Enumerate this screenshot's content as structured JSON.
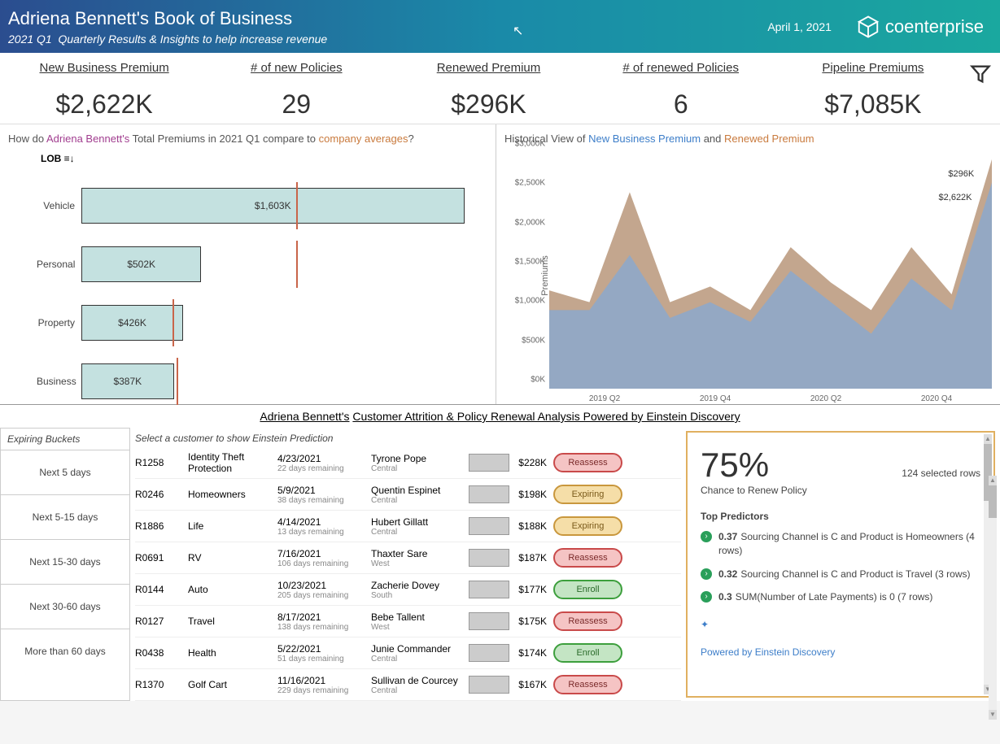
{
  "header": {
    "owner": "Adriena Bennett's",
    "title_rest": "Book of Business",
    "subtitle_period": "2021 Q1",
    "subtitle_rest": "Quarterly Results & Insights to help increase revenue",
    "date": "April 1, 2021",
    "brand": "coenterprise"
  },
  "kpis": [
    {
      "label": "New Business Premium",
      "value": "$2,622K"
    },
    {
      "label": "# of new Policies",
      "value": "29"
    },
    {
      "label": "Renewed Premium",
      "value": "$296K"
    },
    {
      "label": "# of renewed Policies",
      "value": "6"
    },
    {
      "label": "Pipeline Premiums",
      "value": "$7,085K"
    }
  ],
  "chart_data": [
    {
      "type": "bar",
      "title_parts": {
        "pre": "How do ",
        "who": "Adriena Bennett's",
        "mid": " Total Premiums in 2021 Q1 compare to ",
        "ref": "company averages",
        "post": "?"
      },
      "axis_label": "LOB ≡↓",
      "categories": [
        "Vehicle",
        "Personal",
        "Property",
        "Business"
      ],
      "values": [
        1603,
        502,
        426,
        387
      ],
      "value_labels": [
        "$1,603K",
        "$502K",
        "$426K",
        "$387K"
      ],
      "company_avg": [
        900,
        900,
        380,
        400
      ],
      "xmax": 1700
    },
    {
      "type": "area",
      "title_parts": {
        "pre": "Historical View of ",
        "s1": "New Business Premium",
        "mid": " and ",
        "s2": "Renewed Premium"
      },
      "ylabel": "Premiums",
      "y_ticks": [
        "$0K",
        "$500K",
        "$1,000K",
        "$1,500K",
        "$2,000K",
        "$2,500K",
        "$3,000K"
      ],
      "x_ticks": [
        "2019 Q2",
        "2019 Q4",
        "2020 Q2",
        "2020 Q4"
      ],
      "series": [
        {
          "name": "New Business Premium",
          "color": "#8fa8c9",
          "values": [
            1000,
            1000,
            1700,
            900,
            1100,
            850,
            1500,
            1100,
            700,
            1400,
            1000,
            2622
          ]
        },
        {
          "name": "Renewed Premium",
          "color": "#b8977a",
          "values": [
            250,
            100,
            800,
            200,
            200,
            150,
            300,
            250,
            300,
            400,
            200,
            296
          ]
        }
      ],
      "callouts": [
        {
          "text": "$296K",
          "x": 0.96,
          "y": 0.07
        },
        {
          "text": "$2,622K",
          "x": 0.955,
          "y": 0.17
        }
      ],
      "ylim": [
        0,
        3000
      ]
    }
  ],
  "attrition": {
    "title_who": "Adriena Bennett's",
    "title_rest": "Customer Attrition & Policy Renewal Analysis Powered by Einstein Discovery",
    "buckets_head": "Expiring Buckets",
    "table_head": "Select a customer to show Einstein Prediction",
    "buckets": [
      "Next 5 days",
      "Next 5-15 days",
      "Next 15-30 days",
      "Next 30-60 days",
      "More than 60 days"
    ],
    "rows": [
      {
        "id": "R1258",
        "product": "Identity Theft Protection",
        "date": "4/23/2021",
        "days": "22 days remaining",
        "agent": "Tyrone Pope",
        "region": "Central",
        "value": "$228K",
        "action": "Reassess",
        "cls": "reassess"
      },
      {
        "id": "R0246",
        "product": "Homeowners",
        "date": "5/9/2021",
        "days": "38 days remaining",
        "agent": "Quentin Espinet",
        "region": "Central",
        "value": "$198K",
        "action": "Expiring",
        "cls": "expiring"
      },
      {
        "id": "R1886",
        "product": "Life",
        "date": "4/14/2021",
        "days": "13 days remaining",
        "agent": "Hubert Gillatt",
        "region": "Central",
        "value": "$188K",
        "action": "Expiring",
        "cls": "expiring"
      },
      {
        "id": "R0691",
        "product": "RV",
        "date": "7/16/2021",
        "days": "106 days remaining",
        "agent": "Thaxter Sare",
        "region": "West",
        "value": "$187K",
        "action": "Reassess",
        "cls": "reassess"
      },
      {
        "id": "R0144",
        "product": "Auto",
        "date": "10/23/2021",
        "days": "205 days remaining",
        "agent": "Zacherie Dovey",
        "region": "South",
        "value": "$177K",
        "action": "Enroll",
        "cls": "enroll"
      },
      {
        "id": "R0127",
        "product": "Travel",
        "date": "8/17/2021",
        "days": "138 days remaining",
        "agent": "Bebe Tallent",
        "region": "West",
        "value": "$175K",
        "action": "Reassess",
        "cls": "reassess"
      },
      {
        "id": "R0438",
        "product": "Health",
        "date": "5/22/2021",
        "days": "51 days remaining",
        "agent": "Junie Commander",
        "region": "Central",
        "value": "$174K",
        "action": "Enroll",
        "cls": "enroll"
      },
      {
        "id": "R1370",
        "product": "Golf Cart",
        "date": "11/16/2021",
        "days": "229 days remaining",
        "agent": "Sullivan de Courcey",
        "region": "Central",
        "value": "$167K",
        "action": "Reassess",
        "cls": "reassess"
      }
    ]
  },
  "einstein": {
    "percent": "75%",
    "label": "Chance to Renew Policy",
    "selected": "124 selected rows",
    "predictors_head": "Top Predictors",
    "predictors": [
      {
        "score": "0.37",
        "text": "Sourcing Channel is C and Product is Homeowners (4 rows)"
      },
      {
        "score": "0.32",
        "text": "Sourcing Channel is C and Product is Travel (3 rows)"
      },
      {
        "score": "0.3",
        "text": "SUM(Number of Late Payments) is 0 (7 rows)"
      }
    ],
    "powered": "Powered by Einstein Discovery"
  }
}
